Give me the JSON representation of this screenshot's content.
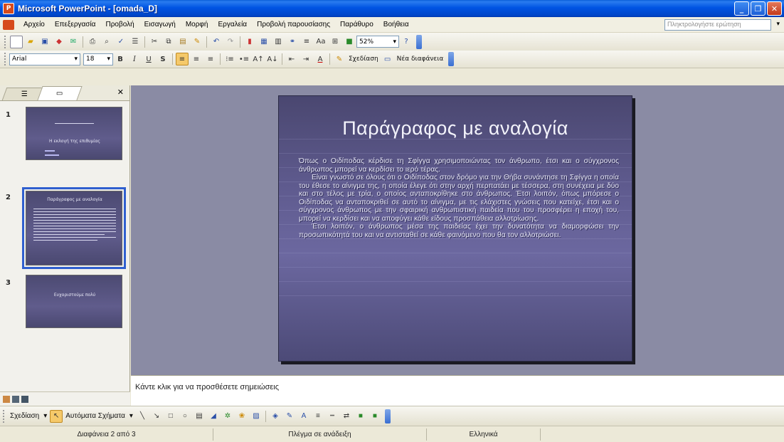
{
  "window": {
    "title": "Microsoft PowerPoint - [omada_D]"
  },
  "menu": {
    "items": [
      "Αρχείο",
      "Επεξεργασία",
      "Προβολή",
      "Εισαγωγή",
      "Μορφή",
      "Εργαλεία",
      "Προβολή παρουσίασης",
      "Παράθυρο",
      "Βοήθεια"
    ],
    "ask_placeholder": "Πληκτρολογήστε ερώτηση"
  },
  "toolbar": {
    "zoom": "52%"
  },
  "formatting": {
    "font": "Arial",
    "size": "18",
    "design_label": "Σχεδίαση",
    "new_slide_label": "Νέα διαφάνεια"
  },
  "slides_panel": {
    "slides": [
      {
        "number": "1",
        "thumb_title": "Η εκλογή της επιθυμίας"
      },
      {
        "number": "2",
        "thumb_title": "Παράγραφος με αναλογία"
      },
      {
        "number": "3",
        "thumb_title": "Ευχαριστούμε πολύ"
      }
    ],
    "selected": 2
  },
  "slide": {
    "title": "Παράγραφος με αναλογία",
    "paragraphs": [
      "Όπως ο Οιδίποδας κέρδισε τη Σφίγγα χρησιμοποιώντας τον άνθρωπο, έτσι και ο σύγχρονος άνθρωπος μπορεί να κερδίσει το ιερό τέρας.",
      "Είναι γνωστό σε όλους ότι ο Οιδίποδας στον δρόμο για την Θήβα συνάντησε τη Σφίγγα η οποία του έθεσε το αίνιγμα της, η οποία έλεγε ότι στην αρχή περπατάει με τέσσερα, στη συνέχεια με δύο και στο τέλος με τρία, ο οποίος ανταποκρίθηκε στο άνθρωπος. Έτσι λοιπόν, όπως μπόρεσε ο Οιδίποδας να ανταποκριθεί σε αυτό το αίνιγμα, με τις ελάχιστες γνώσεις που κατείχε, έτσι και ο σύγχρονος άνθρωπος με την σφαιρική ανθρωπιστική παιδεία που του προσφέρει η εποχή του, μπορεί να κερδίσει και να αποφύγει κάθε είδους προσπάθεια αλλοτρίωσης.",
      "Έτσι λοιπόν, ο άνθρωπος μέσα της παιδείας έχει την δυνατότητα να διαμορφώσει την προσωπικότητά του και να αντισταθεί σε κάθε φαινόμενο που θα τον αλλοτριώσει."
    ]
  },
  "notes": {
    "placeholder": "Κάντε κλικ για να προσθέσετε σημειώσεις"
  },
  "drawing": {
    "draw_label": "Σχεδίαση",
    "autoshapes_label": "Αυτόματα Σχήματα"
  },
  "status": {
    "slide_info": "Διαφάνεια 2 από 3",
    "design": "Πλέγμα σε ανάδειξη",
    "language": "Ελληνικά"
  },
  "colors": {
    "accent": "#0054e3",
    "slide_bg": "#5f5b8f"
  }
}
